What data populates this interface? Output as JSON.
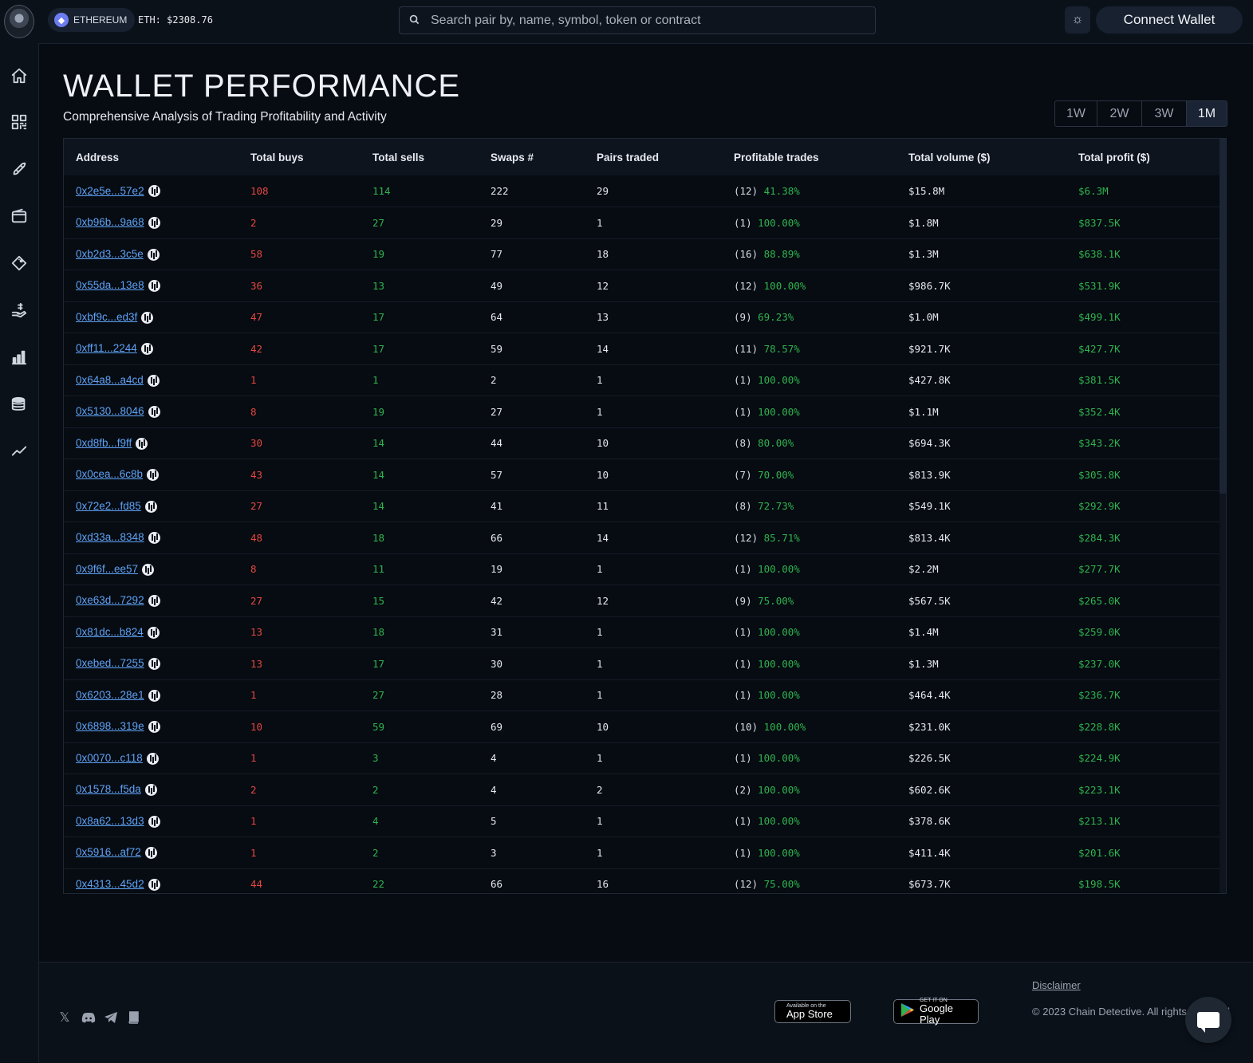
{
  "header": {
    "chain_label": "ETHEREUM",
    "eth_price": "ETH: $2308.76",
    "search_placeholder": "Search pair by, name, symbol, token or contract",
    "connect_label": "Connect Wallet"
  },
  "sidebar": {
    "items": [
      "home-icon",
      "dashboard-icon",
      "rocket-icon",
      "wallet-icon",
      "diamond-icon",
      "hand-coin-icon",
      "bar-chart-icon",
      "coins-icon",
      "trend-line-icon"
    ]
  },
  "page": {
    "title": "WALLET PERFORMANCE",
    "subtitle": "Comprehensive Analysis of Trading Profitability and Activity",
    "ranges": [
      "1W",
      "2W",
      "3W",
      "1M"
    ],
    "selected_range": "1M"
  },
  "table": {
    "headers": [
      "Address",
      "Total buys",
      "Total sells",
      "Swaps #",
      "Pairs traded",
      "Profitable trades",
      "Total volume ($)",
      "Total profit ($)"
    ],
    "rows": [
      {
        "address": "0x2e5e...57e2",
        "buys": "108",
        "sells": "114",
        "swaps": "222",
        "pairs": "29",
        "pt_count": "12",
        "pt_pct": "41.38%",
        "volume": "$15.8M",
        "profit": "$6.3M"
      },
      {
        "address": "0xb96b...9a68",
        "buys": "2",
        "sells": "27",
        "swaps": "29",
        "pairs": "1",
        "pt_count": "1",
        "pt_pct": "100.00%",
        "volume": "$1.8M",
        "profit": "$837.5K"
      },
      {
        "address": "0xb2d3...3c5e",
        "buys": "58",
        "sells": "19",
        "swaps": "77",
        "pairs": "18",
        "pt_count": "16",
        "pt_pct": "88.89%",
        "volume": "$1.3M",
        "profit": "$638.1K"
      },
      {
        "address": "0x55da...13e8",
        "buys": "36",
        "sells": "13",
        "swaps": "49",
        "pairs": "12",
        "pt_count": "12",
        "pt_pct": "100.00%",
        "volume": "$986.7K",
        "profit": "$531.9K"
      },
      {
        "address": "0xbf9c...ed3f",
        "buys": "47",
        "sells": "17",
        "swaps": "64",
        "pairs": "13",
        "pt_count": "9",
        "pt_pct": "69.23%",
        "volume": "$1.0M",
        "profit": "$499.1K"
      },
      {
        "address": "0xff11...2244",
        "buys": "42",
        "sells": "17",
        "swaps": "59",
        "pairs": "14",
        "pt_count": "11",
        "pt_pct": "78.57%",
        "volume": "$921.7K",
        "profit": "$427.7K"
      },
      {
        "address": "0x64a8...a4cd",
        "buys": "1",
        "sells": "1",
        "swaps": "2",
        "pairs": "1",
        "pt_count": "1",
        "pt_pct": "100.00%",
        "volume": "$427.8K",
        "profit": "$381.5K"
      },
      {
        "address": "0x5130...8046",
        "buys": "8",
        "sells": "19",
        "swaps": "27",
        "pairs": "1",
        "pt_count": "1",
        "pt_pct": "100.00%",
        "volume": "$1.1M",
        "profit": "$352.4K"
      },
      {
        "address": "0xd8fb...f9ff",
        "buys": "30",
        "sells": "14",
        "swaps": "44",
        "pairs": "10",
        "pt_count": "8",
        "pt_pct": "80.00%",
        "volume": "$694.3K",
        "profit": "$343.2K"
      },
      {
        "address": "0x0cea...6c8b",
        "buys": "43",
        "sells": "14",
        "swaps": "57",
        "pairs": "10",
        "pt_count": "7",
        "pt_pct": "70.00%",
        "volume": "$813.9K",
        "profit": "$305.8K"
      },
      {
        "address": "0x72e2...fd85",
        "buys": "27",
        "sells": "14",
        "swaps": "41",
        "pairs": "11",
        "pt_count": "8",
        "pt_pct": "72.73%",
        "volume": "$549.1K",
        "profit": "$292.9K"
      },
      {
        "address": "0xd33a...8348",
        "buys": "48",
        "sells": "18",
        "swaps": "66",
        "pairs": "14",
        "pt_count": "12",
        "pt_pct": "85.71%",
        "volume": "$813.4K",
        "profit": "$284.3K"
      },
      {
        "address": "0x9f6f...ee57",
        "buys": "8",
        "sells": "11",
        "swaps": "19",
        "pairs": "1",
        "pt_count": "1",
        "pt_pct": "100.00%",
        "volume": "$2.2M",
        "profit": "$277.7K"
      },
      {
        "address": "0xe63d...7292",
        "buys": "27",
        "sells": "15",
        "swaps": "42",
        "pairs": "12",
        "pt_count": "9",
        "pt_pct": "75.00%",
        "volume": "$567.5K",
        "profit": "$265.0K"
      },
      {
        "address": "0x81dc...b824",
        "buys": "13",
        "sells": "18",
        "swaps": "31",
        "pairs": "1",
        "pt_count": "1",
        "pt_pct": "100.00%",
        "volume": "$1.4M",
        "profit": "$259.0K"
      },
      {
        "address": "0xebed...7255",
        "buys": "13",
        "sells": "17",
        "swaps": "30",
        "pairs": "1",
        "pt_count": "1",
        "pt_pct": "100.00%",
        "volume": "$1.3M",
        "profit": "$237.0K"
      },
      {
        "address": "0x6203...28e1",
        "buys": "1",
        "sells": "27",
        "swaps": "28",
        "pairs": "1",
        "pt_count": "1",
        "pt_pct": "100.00%",
        "volume": "$464.4K",
        "profit": "$236.7K"
      },
      {
        "address": "0x6898...319e",
        "buys": "10",
        "sells": "59",
        "swaps": "69",
        "pairs": "10",
        "pt_count": "10",
        "pt_pct": "100.00%",
        "volume": "$231.0K",
        "profit": "$228.8K"
      },
      {
        "address": "0x0070...c118",
        "buys": "1",
        "sells": "3",
        "swaps": "4",
        "pairs": "1",
        "pt_count": "1",
        "pt_pct": "100.00%",
        "volume": "$226.5K",
        "profit": "$224.9K"
      },
      {
        "address": "0x1578...f5da",
        "buys": "2",
        "sells": "2",
        "swaps": "4",
        "pairs": "2",
        "pt_count": "2",
        "pt_pct": "100.00%",
        "volume": "$602.6K",
        "profit": "$223.1K"
      },
      {
        "address": "0x8a62...13d3",
        "buys": "1",
        "sells": "4",
        "swaps": "5",
        "pairs": "1",
        "pt_count": "1",
        "pt_pct": "100.00%",
        "volume": "$378.6K",
        "profit": "$213.1K"
      },
      {
        "address": "0x5916...af72",
        "buys": "1",
        "sells": "2",
        "swaps": "3",
        "pairs": "1",
        "pt_count": "1",
        "pt_pct": "100.00%",
        "volume": "$411.4K",
        "profit": "$201.6K"
      },
      {
        "address": "0x4313...45d2",
        "buys": "44",
        "sells": "22",
        "swaps": "66",
        "pairs": "16",
        "pt_count": "12",
        "pt_pct": "75.00%",
        "volume": "$673.7K",
        "profit": "$198.5K"
      }
    ]
  },
  "footer": {
    "social": [
      "x-icon",
      "discord-icon",
      "telegram-icon",
      "docs-icon"
    ],
    "app_store_small": "Available on the",
    "app_store_big": "App Store",
    "google_play_small": "GET IT ON",
    "google_play_big": "Google Play",
    "disclaimer": "Disclaimer",
    "copyright": "© 2023 Chain Detective. All rights reserved"
  },
  "colors": {
    "buys": "#e5483f",
    "sells": "#2fb44d",
    "profit": "#2fb44d",
    "link": "#5ea3f5"
  }
}
